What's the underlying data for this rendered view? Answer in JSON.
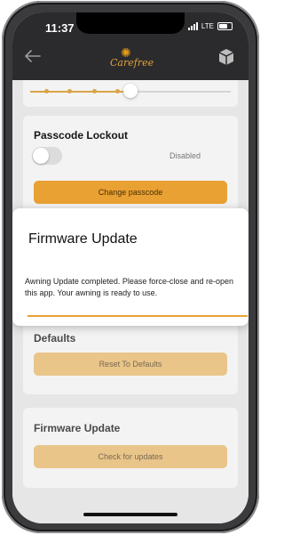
{
  "status_bar": {
    "time": "11:37",
    "network": "LTE"
  },
  "header": {
    "brand": "Carefree"
  },
  "slider": {
    "fraction": 0.5
  },
  "passcode": {
    "title": "Passcode Lockout",
    "toggle_state": "Disabled",
    "button_label": "Change passcode"
  },
  "dialog": {
    "title": "Firmware Update",
    "message": "Awning Update completed. Please force-close and re-open this app. Your awning is ready to use."
  },
  "defaults": {
    "title": "Defaults",
    "button_label": "Reset To Defaults"
  },
  "firmware": {
    "title": "Firmware Update",
    "button_label": "Check for updates"
  },
  "colors": {
    "accent": "#e9a133",
    "header_bg": "#2b2b2d"
  }
}
